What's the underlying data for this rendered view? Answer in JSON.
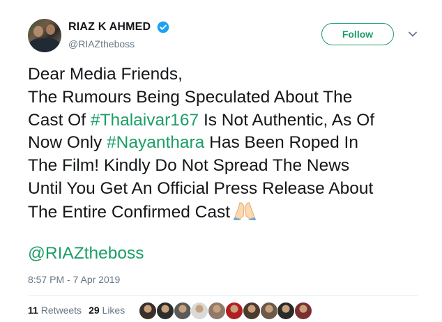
{
  "user": {
    "display_name": "RIAZ K AHMED",
    "handle": "@RIAZtheboss",
    "verified": true,
    "avatar_icon": "profile-photo"
  },
  "follow_button": {
    "label": "Follow"
  },
  "menu_icon": "chevron-down-icon",
  "tweet": {
    "lines": [
      [
        {
          "t": "Dear Media Friends,",
          "k": "text"
        }
      ],
      [
        {
          "t": "The Rumours Being Speculated About The",
          "k": "text"
        }
      ],
      [
        {
          "t": "Cast Of ",
          "k": "text"
        },
        {
          "t": "#Thalaivar167",
          "k": "hashtag"
        },
        {
          "t": " Is Not Authentic, As Of",
          "k": "text"
        }
      ],
      [
        {
          "t": "Now Only ",
          "k": "text"
        },
        {
          "t": "#Nayanthara",
          "k": "hashtag"
        },
        {
          "t": " Has Been Roped In",
          "k": "text"
        }
      ],
      [
        {
          "t": "The Film! Kindly Do Not Spread The News",
          "k": "text"
        }
      ],
      [
        {
          "t": "Until You Get An Official Press Release About",
          "k": "text"
        }
      ],
      [
        {
          "t": "The Entire Confirmed Cast",
          "k": "text"
        }
      ]
    ],
    "emoji": "folded-hands-icon",
    "mention": "@RIAZtheboss"
  },
  "timestamp": "8:57 PM - 7 Apr 2019",
  "stats": {
    "retweets_count": "11",
    "retweets_label": "Retweets",
    "likes_count": "29",
    "likes_label": "Likes"
  },
  "likers": [
    {
      "name": "liker-avatar-1",
      "color": "#3a2f2a"
    },
    {
      "name": "liker-avatar-2",
      "color": "#2c2c2c"
    },
    {
      "name": "liker-avatar-3",
      "color": "#5a5a5a"
    },
    {
      "name": "liker-avatar-4",
      "color": "#d9d9d9"
    },
    {
      "name": "liker-avatar-5",
      "color": "#8c7a6a"
    },
    {
      "name": "liker-avatar-6",
      "color": "#b02020"
    },
    {
      "name": "liker-avatar-7",
      "color": "#4a3a30"
    },
    {
      "name": "liker-avatar-8",
      "color": "#6b5a4a"
    },
    {
      "name": "liker-avatar-9",
      "color": "#2a2a2a"
    },
    {
      "name": "liker-avatar-10",
      "color": "#7a3030"
    }
  ],
  "colors": {
    "link": "#1b9e66",
    "muted": "#657786",
    "verified": "#1da1f2"
  }
}
